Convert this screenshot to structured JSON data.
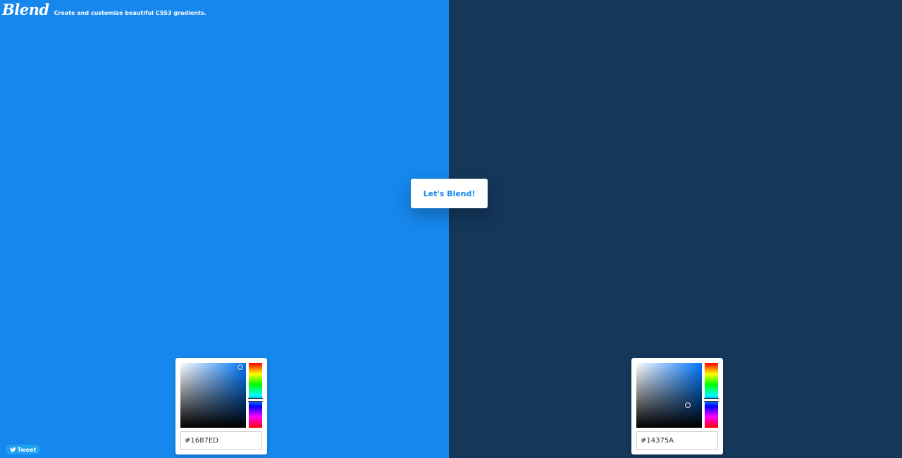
{
  "header": {
    "logo_text": "Blend",
    "tagline": "Create and customize beautiful CSS3 gradients."
  },
  "action": {
    "blend_label": "Let's Blend!"
  },
  "colors": {
    "left": "#1687ED",
    "right": "#14375A",
    "tweet_bg": "#1da1f2"
  },
  "pickers": {
    "left": {
      "hex_value": "#1687ED",
      "hue_color": "#0078ff",
      "saturation": 0.91,
      "brightness": 0.93,
      "hue_fraction": 0.57
    },
    "right": {
      "hex_value": "#14375A",
      "hue_color": "#0078ff",
      "saturation": 0.78,
      "brightness": 0.35,
      "hue_fraction": 0.57
    }
  },
  "footer": {
    "tweet_label": "Tweet",
    "tweet_icon": "twitter-bird-icon"
  }
}
